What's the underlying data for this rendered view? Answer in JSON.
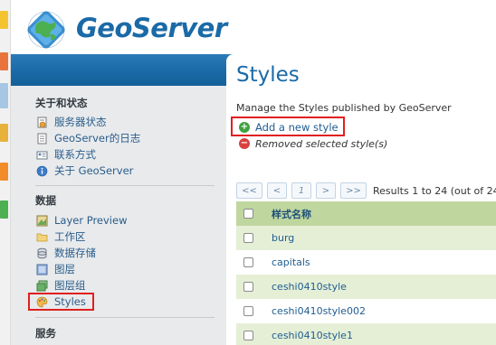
{
  "app": {
    "logo_text": "GeoServer",
    "brand_color": "#1a6aa7"
  },
  "sidebar": {
    "sections": [
      {
        "title": "关于和状态",
        "items": [
          {
            "label": "服务器状态",
            "icon": "server-status-icon"
          },
          {
            "label": "GeoServer的日志",
            "icon": "document-icon"
          },
          {
            "label": "联系方式",
            "icon": "contact-card-icon"
          },
          {
            "label": "关于 GeoServer",
            "icon": "info-icon"
          }
        ]
      },
      {
        "title": "数据",
        "items": [
          {
            "label": "Layer Preview",
            "icon": "layer-preview-icon"
          },
          {
            "label": "工作区",
            "icon": "folder-icon"
          },
          {
            "label": "数据存储",
            "icon": "database-icon"
          },
          {
            "label": "图层",
            "icon": "layer-icon"
          },
          {
            "label": "图层组",
            "icon": "layer-group-icon"
          },
          {
            "label": "Styles",
            "icon": "palette-icon"
          }
        ]
      },
      {
        "title": "服务",
        "items": []
      }
    ]
  },
  "main": {
    "title": "Styles",
    "description": "Manage the Styles published by GeoServer",
    "add_label": "Add a new style",
    "removed_label": "Removed selected style(s)",
    "pager": {
      "first": "<<",
      "prev": "<",
      "page": "1",
      "next": ">",
      "last": ">>",
      "info": "Results 1 to 24 (out of 24"
    },
    "table": {
      "header": "样式名称",
      "rows": [
        "burg",
        "capitals",
        "ceshi0410style",
        "ceshi0410style002",
        "ceshi0410style1"
      ]
    }
  },
  "colors": {
    "header_band": "#1a6aa7",
    "table_header": "#bfd79f",
    "table_row_alt": "#e5efd6",
    "highlight": "#e02020"
  }
}
